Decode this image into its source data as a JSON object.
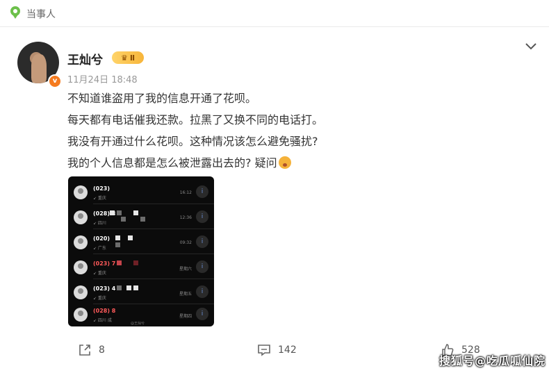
{
  "header": {
    "label": "当事人"
  },
  "post": {
    "author": "王灿兮",
    "badge": "Ⅱ",
    "time": "11月24日 18:48",
    "lines": [
      "不知道谁盗用了我的信息开通了花呗。",
      "每天都有电话催我还款。拉黑了又换不同的电话打。",
      "我没有开通过什么花呗。这种情况该怎么避免骚扰?",
      "我的个人信息都是怎么被泄露出去的? 疑问"
    ]
  },
  "call_log": {
    "rows": [
      {
        "number": "(023)",
        "location": "↙ 重庆",
        "when": "16:12",
        "missed": false
      },
      {
        "number": "(028) 8",
        "location": "↙ 四川",
        "when": "12:36",
        "missed": false
      },
      {
        "number": "(020)",
        "location": "↙ 广东",
        "when": "09:32",
        "missed": false
      },
      {
        "number": "(023) 7",
        "location": "↙ 重庆",
        "when": "星期六",
        "missed": true
      },
      {
        "number": "(023) 4",
        "location": "↙ 重庆",
        "when": "星期五",
        "missed": false
      },
      {
        "number": "(028) 8",
        "location": "↙ 四川 成",
        "when": "星期四",
        "missed": true
      }
    ],
    "watermark": "@王灿兮"
  },
  "actions": {
    "share_count": "8",
    "comment_count": "142",
    "like_count": "528"
  },
  "watermark": "搜狐号@吃瓜呱仙院"
}
